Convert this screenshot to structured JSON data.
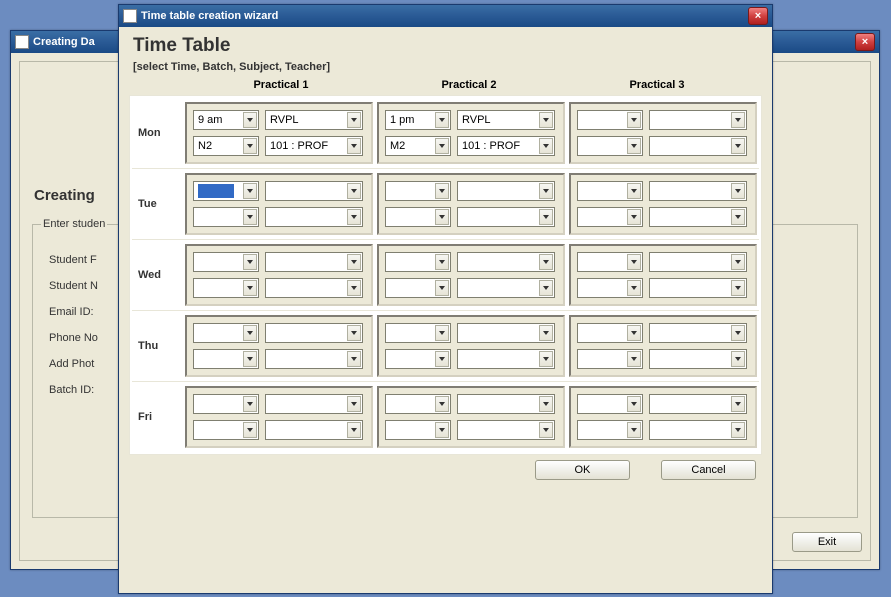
{
  "background_window": {
    "title": "Creating Da",
    "heading": "Creating",
    "fieldset_legend": "Enter studen",
    "rows": [
      "Student F",
      "Student N",
      "Email ID:",
      "Phone No",
      "Add Phot",
      "Batch ID:"
    ],
    "exit_label": "Exit"
  },
  "wizard": {
    "title": "Time table creation wizard",
    "heading": "Time Table",
    "subheading": "[select Time, Batch, Subject, Teacher]",
    "columns": [
      "Practical 1",
      "Practical 2",
      "Practical 3"
    ],
    "days": [
      "Mon",
      "Tue",
      "Wed",
      "Thu",
      "Fri"
    ],
    "cells": {
      "Mon": {
        "Practical 1": {
          "time": "9 am",
          "subject": "RVPL",
          "batch": "N2",
          "teacher": "101 : PROF"
        },
        "Practical 2": {
          "time": "1 pm",
          "subject": "RVPL",
          "batch": "M2",
          "teacher": "101 : PROF"
        },
        "Practical 3": {
          "time": "",
          "subject": "",
          "batch": "",
          "teacher": ""
        }
      },
      "Tue": {
        "Practical 1": {
          "time": "",
          "subject": "",
          "batch": "",
          "teacher": "",
          "time_focused": true
        },
        "Practical 2": {
          "time": "",
          "subject": "",
          "batch": "",
          "teacher": ""
        },
        "Practical 3": {
          "time": "",
          "subject": "",
          "batch": "",
          "teacher": ""
        }
      },
      "Wed": {
        "Practical 1": {
          "time": "",
          "subject": "",
          "batch": "",
          "teacher": ""
        },
        "Practical 2": {
          "time": "",
          "subject": "",
          "batch": "",
          "teacher": ""
        },
        "Practical 3": {
          "time": "",
          "subject": "",
          "batch": "",
          "teacher": ""
        }
      },
      "Thu": {
        "Practical 1": {
          "time": "",
          "subject": "",
          "batch": "",
          "teacher": ""
        },
        "Practical 2": {
          "time": "",
          "subject": "",
          "batch": "",
          "teacher": ""
        },
        "Practical 3": {
          "time": "",
          "subject": "",
          "batch": "",
          "teacher": ""
        }
      },
      "Fri": {
        "Practical 1": {
          "time": "",
          "subject": "",
          "batch": "",
          "teacher": ""
        },
        "Practical 2": {
          "time": "",
          "subject": "",
          "batch": "",
          "teacher": ""
        },
        "Practical 3": {
          "time": "",
          "subject": "",
          "batch": "",
          "teacher": ""
        }
      }
    },
    "ok_label": "OK",
    "cancel_label": "Cancel"
  }
}
